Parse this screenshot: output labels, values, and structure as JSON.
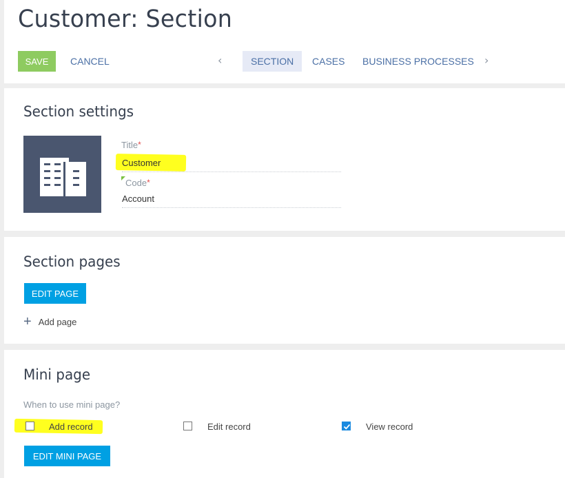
{
  "header": {
    "title": "Customer: Section",
    "save_label": "SAVE",
    "cancel_label": "CANCEL",
    "prev_arrow": "‹",
    "next_arrow": "›",
    "tabs": [
      {
        "label": "SECTION",
        "active": true
      },
      {
        "label": "CASES",
        "active": false
      },
      {
        "label": "BUSINESS PROCESSES",
        "active": false
      }
    ]
  },
  "settings": {
    "title": "Section settings",
    "icon": "building-icon",
    "fields": [
      {
        "label": "Title",
        "required_mark": "*",
        "value": "Customer"
      },
      {
        "label": "Code",
        "required_mark": "*",
        "value": "Account"
      }
    ]
  },
  "pages": {
    "title": "Section pages",
    "edit_button": "EDIT PAGE",
    "add_plus": "+",
    "add_label": "Add page"
  },
  "mini": {
    "title": "Mini page",
    "question": "When to use mini page?",
    "options": [
      {
        "label": "Add record",
        "checked": false
      },
      {
        "label": "Edit record",
        "checked": false
      },
      {
        "label": "View record",
        "checked": true
      }
    ],
    "edit_button": "EDIT MINI PAGE"
  },
  "colors": {
    "save": "#8ecb60",
    "primary": "#00a0e3",
    "highlight": "#ffff1f",
    "icon_bg": "#4a566f"
  }
}
